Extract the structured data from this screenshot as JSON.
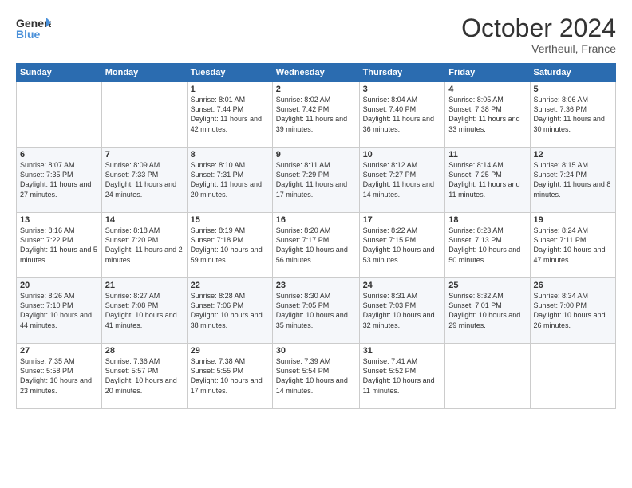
{
  "header": {
    "logo_line1": "General",
    "logo_line2": "Blue",
    "month": "October 2024",
    "location": "Vertheuil, France"
  },
  "weekdays": [
    "Sunday",
    "Monday",
    "Tuesday",
    "Wednesday",
    "Thursday",
    "Friday",
    "Saturday"
  ],
  "weeks": [
    [
      {
        "day": "",
        "info": ""
      },
      {
        "day": "",
        "info": ""
      },
      {
        "day": "1",
        "info": "Sunrise: 8:01 AM\nSunset: 7:44 PM\nDaylight: 11 hours and 42 minutes."
      },
      {
        "day": "2",
        "info": "Sunrise: 8:02 AM\nSunset: 7:42 PM\nDaylight: 11 hours and 39 minutes."
      },
      {
        "day": "3",
        "info": "Sunrise: 8:04 AM\nSunset: 7:40 PM\nDaylight: 11 hours and 36 minutes."
      },
      {
        "day": "4",
        "info": "Sunrise: 8:05 AM\nSunset: 7:38 PM\nDaylight: 11 hours and 33 minutes."
      },
      {
        "day": "5",
        "info": "Sunrise: 8:06 AM\nSunset: 7:36 PM\nDaylight: 11 hours and 30 minutes."
      }
    ],
    [
      {
        "day": "6",
        "info": "Sunrise: 8:07 AM\nSunset: 7:35 PM\nDaylight: 11 hours and 27 minutes."
      },
      {
        "day": "7",
        "info": "Sunrise: 8:09 AM\nSunset: 7:33 PM\nDaylight: 11 hours and 24 minutes."
      },
      {
        "day": "8",
        "info": "Sunrise: 8:10 AM\nSunset: 7:31 PM\nDaylight: 11 hours and 20 minutes."
      },
      {
        "day": "9",
        "info": "Sunrise: 8:11 AM\nSunset: 7:29 PM\nDaylight: 11 hours and 17 minutes."
      },
      {
        "day": "10",
        "info": "Sunrise: 8:12 AM\nSunset: 7:27 PM\nDaylight: 11 hours and 14 minutes."
      },
      {
        "day": "11",
        "info": "Sunrise: 8:14 AM\nSunset: 7:25 PM\nDaylight: 11 hours and 11 minutes."
      },
      {
        "day": "12",
        "info": "Sunrise: 8:15 AM\nSunset: 7:24 PM\nDaylight: 11 hours and 8 minutes."
      }
    ],
    [
      {
        "day": "13",
        "info": "Sunrise: 8:16 AM\nSunset: 7:22 PM\nDaylight: 11 hours and 5 minutes."
      },
      {
        "day": "14",
        "info": "Sunrise: 8:18 AM\nSunset: 7:20 PM\nDaylight: 11 hours and 2 minutes."
      },
      {
        "day": "15",
        "info": "Sunrise: 8:19 AM\nSunset: 7:18 PM\nDaylight: 10 hours and 59 minutes."
      },
      {
        "day": "16",
        "info": "Sunrise: 8:20 AM\nSunset: 7:17 PM\nDaylight: 10 hours and 56 minutes."
      },
      {
        "day": "17",
        "info": "Sunrise: 8:22 AM\nSunset: 7:15 PM\nDaylight: 10 hours and 53 minutes."
      },
      {
        "day": "18",
        "info": "Sunrise: 8:23 AM\nSunset: 7:13 PM\nDaylight: 10 hours and 50 minutes."
      },
      {
        "day": "19",
        "info": "Sunrise: 8:24 AM\nSunset: 7:11 PM\nDaylight: 10 hours and 47 minutes."
      }
    ],
    [
      {
        "day": "20",
        "info": "Sunrise: 8:26 AM\nSunset: 7:10 PM\nDaylight: 10 hours and 44 minutes."
      },
      {
        "day": "21",
        "info": "Sunrise: 8:27 AM\nSunset: 7:08 PM\nDaylight: 10 hours and 41 minutes."
      },
      {
        "day": "22",
        "info": "Sunrise: 8:28 AM\nSunset: 7:06 PM\nDaylight: 10 hours and 38 minutes."
      },
      {
        "day": "23",
        "info": "Sunrise: 8:30 AM\nSunset: 7:05 PM\nDaylight: 10 hours and 35 minutes."
      },
      {
        "day": "24",
        "info": "Sunrise: 8:31 AM\nSunset: 7:03 PM\nDaylight: 10 hours and 32 minutes."
      },
      {
        "day": "25",
        "info": "Sunrise: 8:32 AM\nSunset: 7:01 PM\nDaylight: 10 hours and 29 minutes."
      },
      {
        "day": "26",
        "info": "Sunrise: 8:34 AM\nSunset: 7:00 PM\nDaylight: 10 hours and 26 minutes."
      }
    ],
    [
      {
        "day": "27",
        "info": "Sunrise: 7:35 AM\nSunset: 5:58 PM\nDaylight: 10 hours and 23 minutes."
      },
      {
        "day": "28",
        "info": "Sunrise: 7:36 AM\nSunset: 5:57 PM\nDaylight: 10 hours and 20 minutes."
      },
      {
        "day": "29",
        "info": "Sunrise: 7:38 AM\nSunset: 5:55 PM\nDaylight: 10 hours and 17 minutes."
      },
      {
        "day": "30",
        "info": "Sunrise: 7:39 AM\nSunset: 5:54 PM\nDaylight: 10 hours and 14 minutes."
      },
      {
        "day": "31",
        "info": "Sunrise: 7:41 AM\nSunset: 5:52 PM\nDaylight: 10 hours and 11 minutes."
      },
      {
        "day": "",
        "info": ""
      },
      {
        "day": "",
        "info": ""
      }
    ]
  ]
}
